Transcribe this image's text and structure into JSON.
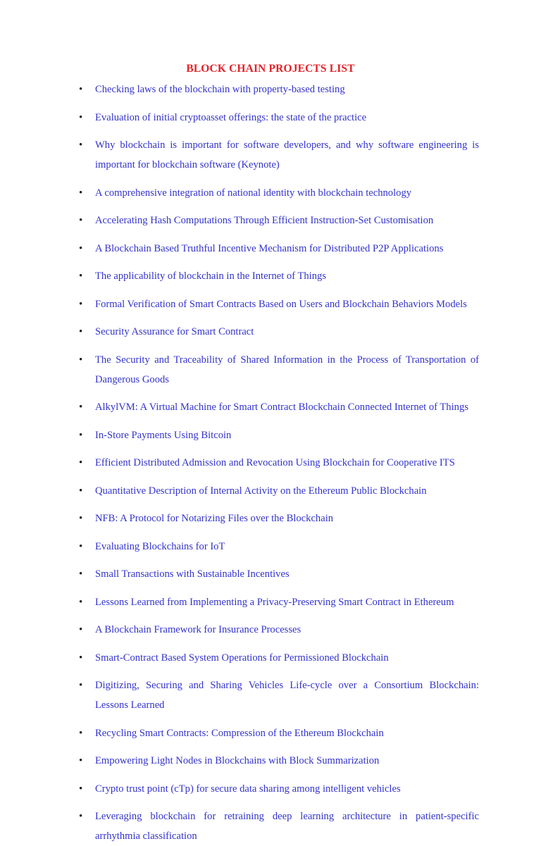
{
  "document": {
    "title": "BLOCK CHAIN PROJECTS LIST",
    "title_color": "#e32228",
    "body_color": "#3333cc",
    "bullet_color": "#1a1a1a",
    "background_color": "#ffffff",
    "bullet_glyph": "•",
    "items": [
      {
        "text": "Checking laws of the blockchain with property-based testing",
        "wraps": false
      },
      {
        "text": "Evaluation of initial cryptoasset offerings: the state of the practice",
        "wraps": false
      },
      {
        "text": "Why blockchain is important for software developers, and why software engineering is important for blockchain software (Keynote)",
        "wraps": true
      },
      {
        "text": "A comprehensive integration of national identity with blockchain technology",
        "wraps": false
      },
      {
        "text": "Accelerating Hash Computations Through Efficient Instruction-Set Customisation",
        "wraps": false
      },
      {
        "text": "A Blockchain Based Truthful Incentive Mechanism for Distributed P2P Applications",
        "wraps": false
      },
      {
        "text": "The applicability of blockchain in the Internet of Things",
        "wraps": false
      },
      {
        "text": "Formal Verification of Smart Contracts Based on Users and Blockchain Behaviors Models",
        "wraps": false
      },
      {
        "text": "Security Assurance for Smart Contract",
        "wraps": false
      },
      {
        "text": "The Security and Traceability of Shared Information in the Process of Transportation of Dangerous Goods",
        "wraps": true
      },
      {
        "text": "AlkylVM: A Virtual Machine for Smart Contract Blockchain Connected Internet of Things",
        "wraps": false
      },
      {
        "text": "In-Store Payments Using Bitcoin",
        "wraps": false
      },
      {
        "text": "Efficient Distributed Admission and Revocation Using Blockchain for Cooperative ITS",
        "wraps": false
      },
      {
        "text": "Quantitative Description of Internal Activity on the Ethereum Public Blockchain",
        "wraps": false
      },
      {
        "text": "NFB: A Protocol for Notarizing Files over the Blockchain",
        "wraps": false
      },
      {
        "text": "Evaluating Blockchains for IoT",
        "wraps": false
      },
      {
        "text": "Small Transactions with Sustainable Incentives",
        "wraps": false
      },
      {
        "text": "Lessons Learned from Implementing a Privacy-Preserving Smart Contract in Ethereum",
        "wraps": false
      },
      {
        "text": "A Blockchain Framework for Insurance Processes",
        "wraps": false
      },
      {
        "text": "Smart-Contract Based System Operations for Permissioned Blockchain",
        "wraps": false
      },
      {
        "text": "Digitizing, Securing and Sharing Vehicles Life-cycle over a Consortium Blockchain: Lessons Learned",
        "wraps": true
      },
      {
        "text": "Recycling Smart Contracts: Compression of the Ethereum Blockchain",
        "wraps": false
      },
      {
        "text": "Empowering Light Nodes in Blockchains with Block Summarization",
        "wraps": false
      },
      {
        "text": "Crypto trust point (cTp) for secure data sharing among intelligent vehicles",
        "wraps": false
      },
      {
        "text": "Leveraging blockchain for retraining deep learning architecture in patient-specific arrhythmia classification",
        "wraps": true
      }
    ]
  }
}
